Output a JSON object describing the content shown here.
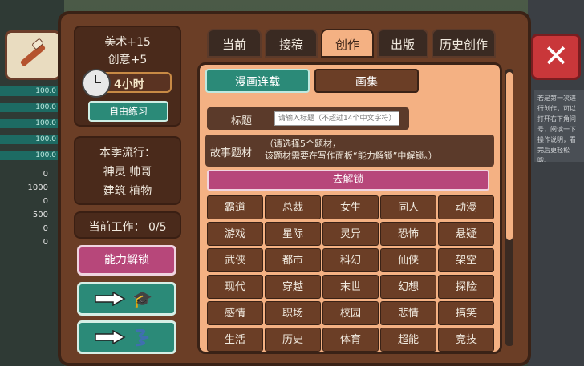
{
  "background": {
    "left_stats": [
      "100.0",
      "100.0",
      "100.0",
      "100.0",
      "100.0"
    ],
    "left_numbers": [
      "0",
      "1000",
      "0",
      "500",
      "0",
      "0"
    ]
  },
  "right_note": "若是第一次进行创作，可以打开右下角问号，阅读一下操作说明，看完后更轻松哦。",
  "close_label": "✕",
  "left_panel": {
    "bonus_art": "美术+15",
    "bonus_creativity": "创意+5",
    "time": "4小时",
    "free_practice": "自由练习",
    "trend_title": "本季流行：",
    "trend_line1": "神灵  帅哥",
    "trend_line2": "建筑  植物",
    "current_work": "当前工作：  0/5",
    "ability_unlock": "能力解锁"
  },
  "tabs": [
    "当前",
    "接稿",
    "创作",
    "出版",
    "历史创作"
  ],
  "active_tab_index": 2,
  "subtabs": {
    "manga": "漫画连载",
    "album": "画集"
  },
  "title_row": {
    "label": "标题",
    "placeholder": "请输入标题（不超过14个中文字符）"
  },
  "story_row": {
    "label": "故事题材",
    "hint1": "（请选择5个题材，",
    "hint2": "该题材需要在写作面板“能力解锁”中解锁。）"
  },
  "unlock_bar": "去解锁",
  "genres": [
    [
      "霸道",
      "总裁",
      "女生",
      "同人",
      "动漫"
    ],
    [
      "游戏",
      "星际",
      "灵异",
      "恐怖",
      "悬疑"
    ],
    [
      "武侠",
      "都市",
      "科幻",
      "仙侠",
      "架空"
    ],
    [
      "现代",
      "穿越",
      "末世",
      "幻想",
      "探险"
    ],
    [
      "感情",
      "职场",
      "校园",
      "悲情",
      "搞笑"
    ],
    [
      "生活",
      "历史",
      "体育",
      "超能",
      "竞技"
    ]
  ],
  "colors": {
    "accent_teal": "#2b8a78",
    "accent_pink": "#b7477a",
    "panel_peach": "#f4b183",
    "wood": "#6b3e26"
  }
}
